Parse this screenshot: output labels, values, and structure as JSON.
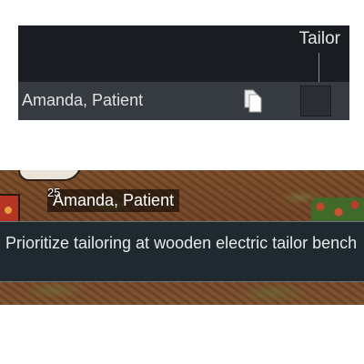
{
  "work_tab": {
    "column_header": "Tailor",
    "pawn_name": "Amanda, Patient",
    "copy_icon": "copy-icon"
  },
  "map": {
    "pawn_number": "25",
    "pawn_label": "Amanda, Patient"
  },
  "tooltip": {
    "text": "Prioritize tailoring at wooden electric tailor bench"
  },
  "colors": {
    "panel_bg": "#191d22",
    "row_bg": "#363b41",
    "tooltip_bg": "#1f2a30"
  }
}
